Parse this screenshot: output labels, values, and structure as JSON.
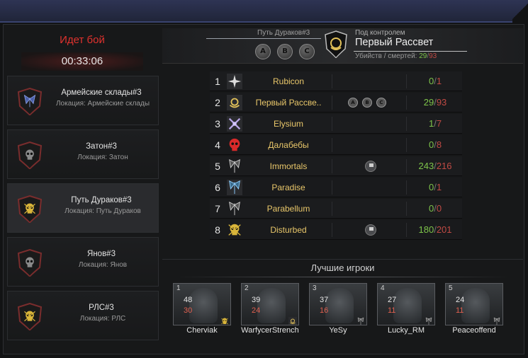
{
  "battle": {
    "title": "Идет бой",
    "timer": "00:33:06"
  },
  "locations": [
    {
      "name": "Армейские склады#3",
      "sub": "Локация: Армейские склады",
      "emblem": "blue-eagle-icon"
    },
    {
      "name": "Затон#3",
      "sub": "Локация: Затон",
      "emblem": "skull-icon"
    },
    {
      "name": "Путь Дураков#3",
      "sub": "Локация: Путь Дураков",
      "emblem": "yellow-skull-icon"
    },
    {
      "name": "Янов#3",
      "sub": "Локация: Янов",
      "emblem": "skull-icon"
    },
    {
      "name": "РЛС#3",
      "sub": "Локация: РЛС",
      "emblem": "yellow-skull-icon"
    }
  ],
  "header": {
    "location_label": "Путь Дураков#3",
    "points": [
      "A",
      "B",
      "C"
    ],
    "control_label": "Под контролем",
    "control_clan": "Первый Рассвет",
    "stats_label": "Убийств / смертей:",
    "kills": "29",
    "deaths": "93"
  },
  "clans": [
    {
      "rank": "1",
      "name": "Rubicon",
      "kills": "0",
      "deaths": "1",
      "emblem": "star-icon",
      "points": [],
      "flag": false
    },
    {
      "rank": "2",
      "name": "Первый Рассве..",
      "kills": "29",
      "deaths": "93",
      "emblem": "gold-wreath-icon",
      "points": [
        "A",
        "B",
        "C"
      ],
      "flag": false
    },
    {
      "rank": "3",
      "name": "Elysium",
      "kills": "1",
      "deaths": "7",
      "emblem": "crossed-icon",
      "points": [],
      "flag": false
    },
    {
      "rank": "4",
      "name": "Далабебы",
      "kills": "0",
      "deaths": "8",
      "emblem": "red-skull-icon",
      "points": [],
      "flag": false
    },
    {
      "rank": "5",
      "name": "Immortals",
      "kills": "243",
      "deaths": "216",
      "emblem": "wings-icon",
      "points": [],
      "flag": true
    },
    {
      "rank": "6",
      "name": "Paradise",
      "kills": "0",
      "deaths": "1",
      "emblem": "blue-wings-icon",
      "points": [],
      "flag": false
    },
    {
      "rank": "7",
      "name": "Parabellum",
      "kills": "0",
      "deaths": "0",
      "emblem": "wings-icon",
      "points": [],
      "flag": false
    },
    {
      "rank": "8",
      "name": "Disturbed",
      "kills": "180",
      "deaths": "201",
      "emblem": "yellow-skull-icon",
      "points": [],
      "flag": true
    }
  ],
  "best": {
    "title": "Лучшие игроки",
    "players": [
      {
        "index": "1",
        "kills": "48",
        "deaths": "30",
        "name": "Cherviak",
        "badge": "yellow-skull-icon"
      },
      {
        "index": "2",
        "kills": "39",
        "deaths": "24",
        "name": "WarfycerStrench",
        "badge": "gold-wreath-icon"
      },
      {
        "index": "3",
        "kills": "37",
        "deaths": "16",
        "name": "YeSy",
        "badge": "wings-icon"
      },
      {
        "index": "4",
        "kills": "27",
        "deaths": "11",
        "name": "Lucky_RM",
        "badge": "wings-icon"
      },
      {
        "index": "5",
        "kills": "24",
        "deaths": "11",
        "name": "Peaceoffend",
        "badge": "wings-icon"
      }
    ]
  },
  "colors": {
    "accent_red": "#e0322e",
    "kills": "#7ec44a",
    "deaths": "#c04a44",
    "clan_name": "#e9c76a",
    "topbar": "#2e3454"
  }
}
